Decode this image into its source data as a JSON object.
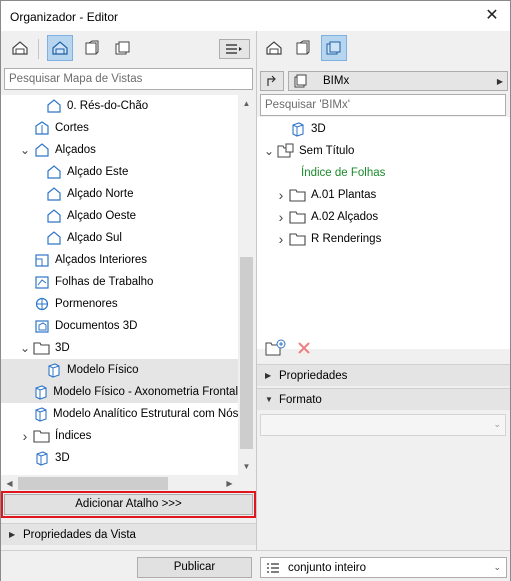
{
  "window": {
    "title": "Organizador - Editor",
    "close_glyph": "✕"
  },
  "left": {
    "search_placeholder": "Pesquisar Mapa de Vistas",
    "tree": [
      {
        "label": "0. Rés-do-Chão",
        "icon": "floor-plan-icon",
        "indent": 2,
        "twisty": ""
      },
      {
        "label": "Cortes",
        "icon": "section-icon",
        "indent": 1,
        "twisty": ""
      },
      {
        "label": "Alçados",
        "icon": "elevation-icon",
        "indent": 1,
        "twisty": "down"
      },
      {
        "label": "Alçado Este",
        "icon": "elevation-icon",
        "indent": 2,
        "twisty": ""
      },
      {
        "label": "Alçado Norte",
        "icon": "elevation-icon",
        "indent": 2,
        "twisty": ""
      },
      {
        "label": "Alçado Oeste",
        "icon": "elevation-icon",
        "indent": 2,
        "twisty": ""
      },
      {
        "label": "Alçado Sul",
        "icon": "elevation-icon",
        "indent": 2,
        "twisty": ""
      },
      {
        "label": "Alçados Interiores",
        "icon": "interior-elevation-icon",
        "indent": 1,
        "twisty": ""
      },
      {
        "label": "Folhas de Trabalho",
        "icon": "worksheet-icon",
        "indent": 1,
        "twisty": ""
      },
      {
        "label": "Pormenores",
        "icon": "detail-icon",
        "indent": 1,
        "twisty": ""
      },
      {
        "label": "Documentos 3D",
        "icon": "3d-document-icon",
        "indent": 1,
        "twisty": ""
      },
      {
        "label": "3D",
        "icon": "folder-icon",
        "indent": 1,
        "twisty": "down"
      },
      {
        "label": "Modelo Físico",
        "icon": "3d-cube-icon",
        "indent": 2,
        "twisty": "",
        "selected": true
      },
      {
        "label": "Modelo Físico - Axonometria Frontal",
        "icon": "3d-cube-icon",
        "indent": 2,
        "twisty": "",
        "selected": true
      },
      {
        "label": "Modelo Analítico Estrutural com Nós",
        "icon": "3d-cube-icon",
        "indent": 2,
        "twisty": ""
      },
      {
        "label": "Índices",
        "icon": "folder-icon",
        "indent": 1,
        "twisty": "right"
      },
      {
        "label": "3D",
        "icon": "3d-cube-icon",
        "indent": 1,
        "twisty": ""
      }
    ],
    "add_shortcut_label": "Adicionar Atalho >>>",
    "view_properties_label": "Propriedades da Vista"
  },
  "right": {
    "bimx_label": "BIMx",
    "search_placeholder": "Pesquisar 'BIMx'",
    "tree": [
      {
        "label": "3D",
        "icon": "3d-cube-icon",
        "indent": 1,
        "twisty": "",
        "green": false
      },
      {
        "label": "Sem Título",
        "icon": "publisher-set-icon",
        "indent": 0,
        "twisty": "down",
        "green": false
      },
      {
        "label": "Índice de Folhas",
        "icon": "",
        "indent": 2,
        "twisty": "",
        "green": true
      },
      {
        "label": "A.01 Plantas",
        "icon": "folder-icon",
        "indent": 1,
        "twisty": "right",
        "green": false
      },
      {
        "label": "A.02 Alçados",
        "icon": "folder-icon",
        "indent": 1,
        "twisty": "right",
        "green": false
      },
      {
        "label": "R Renderings",
        "icon": "folder-icon",
        "indent": 1,
        "twisty": "right",
        "green": false
      }
    ],
    "properties_label": "Propriedades",
    "format_label": "Formato"
  },
  "bottom": {
    "publish_label": "Publicar",
    "set_label": "conjunto inteiro"
  },
  "colors": {
    "accent": "#2e75c8",
    "highlight_border": "#e0161e",
    "green_text": "#1a8a2b"
  }
}
